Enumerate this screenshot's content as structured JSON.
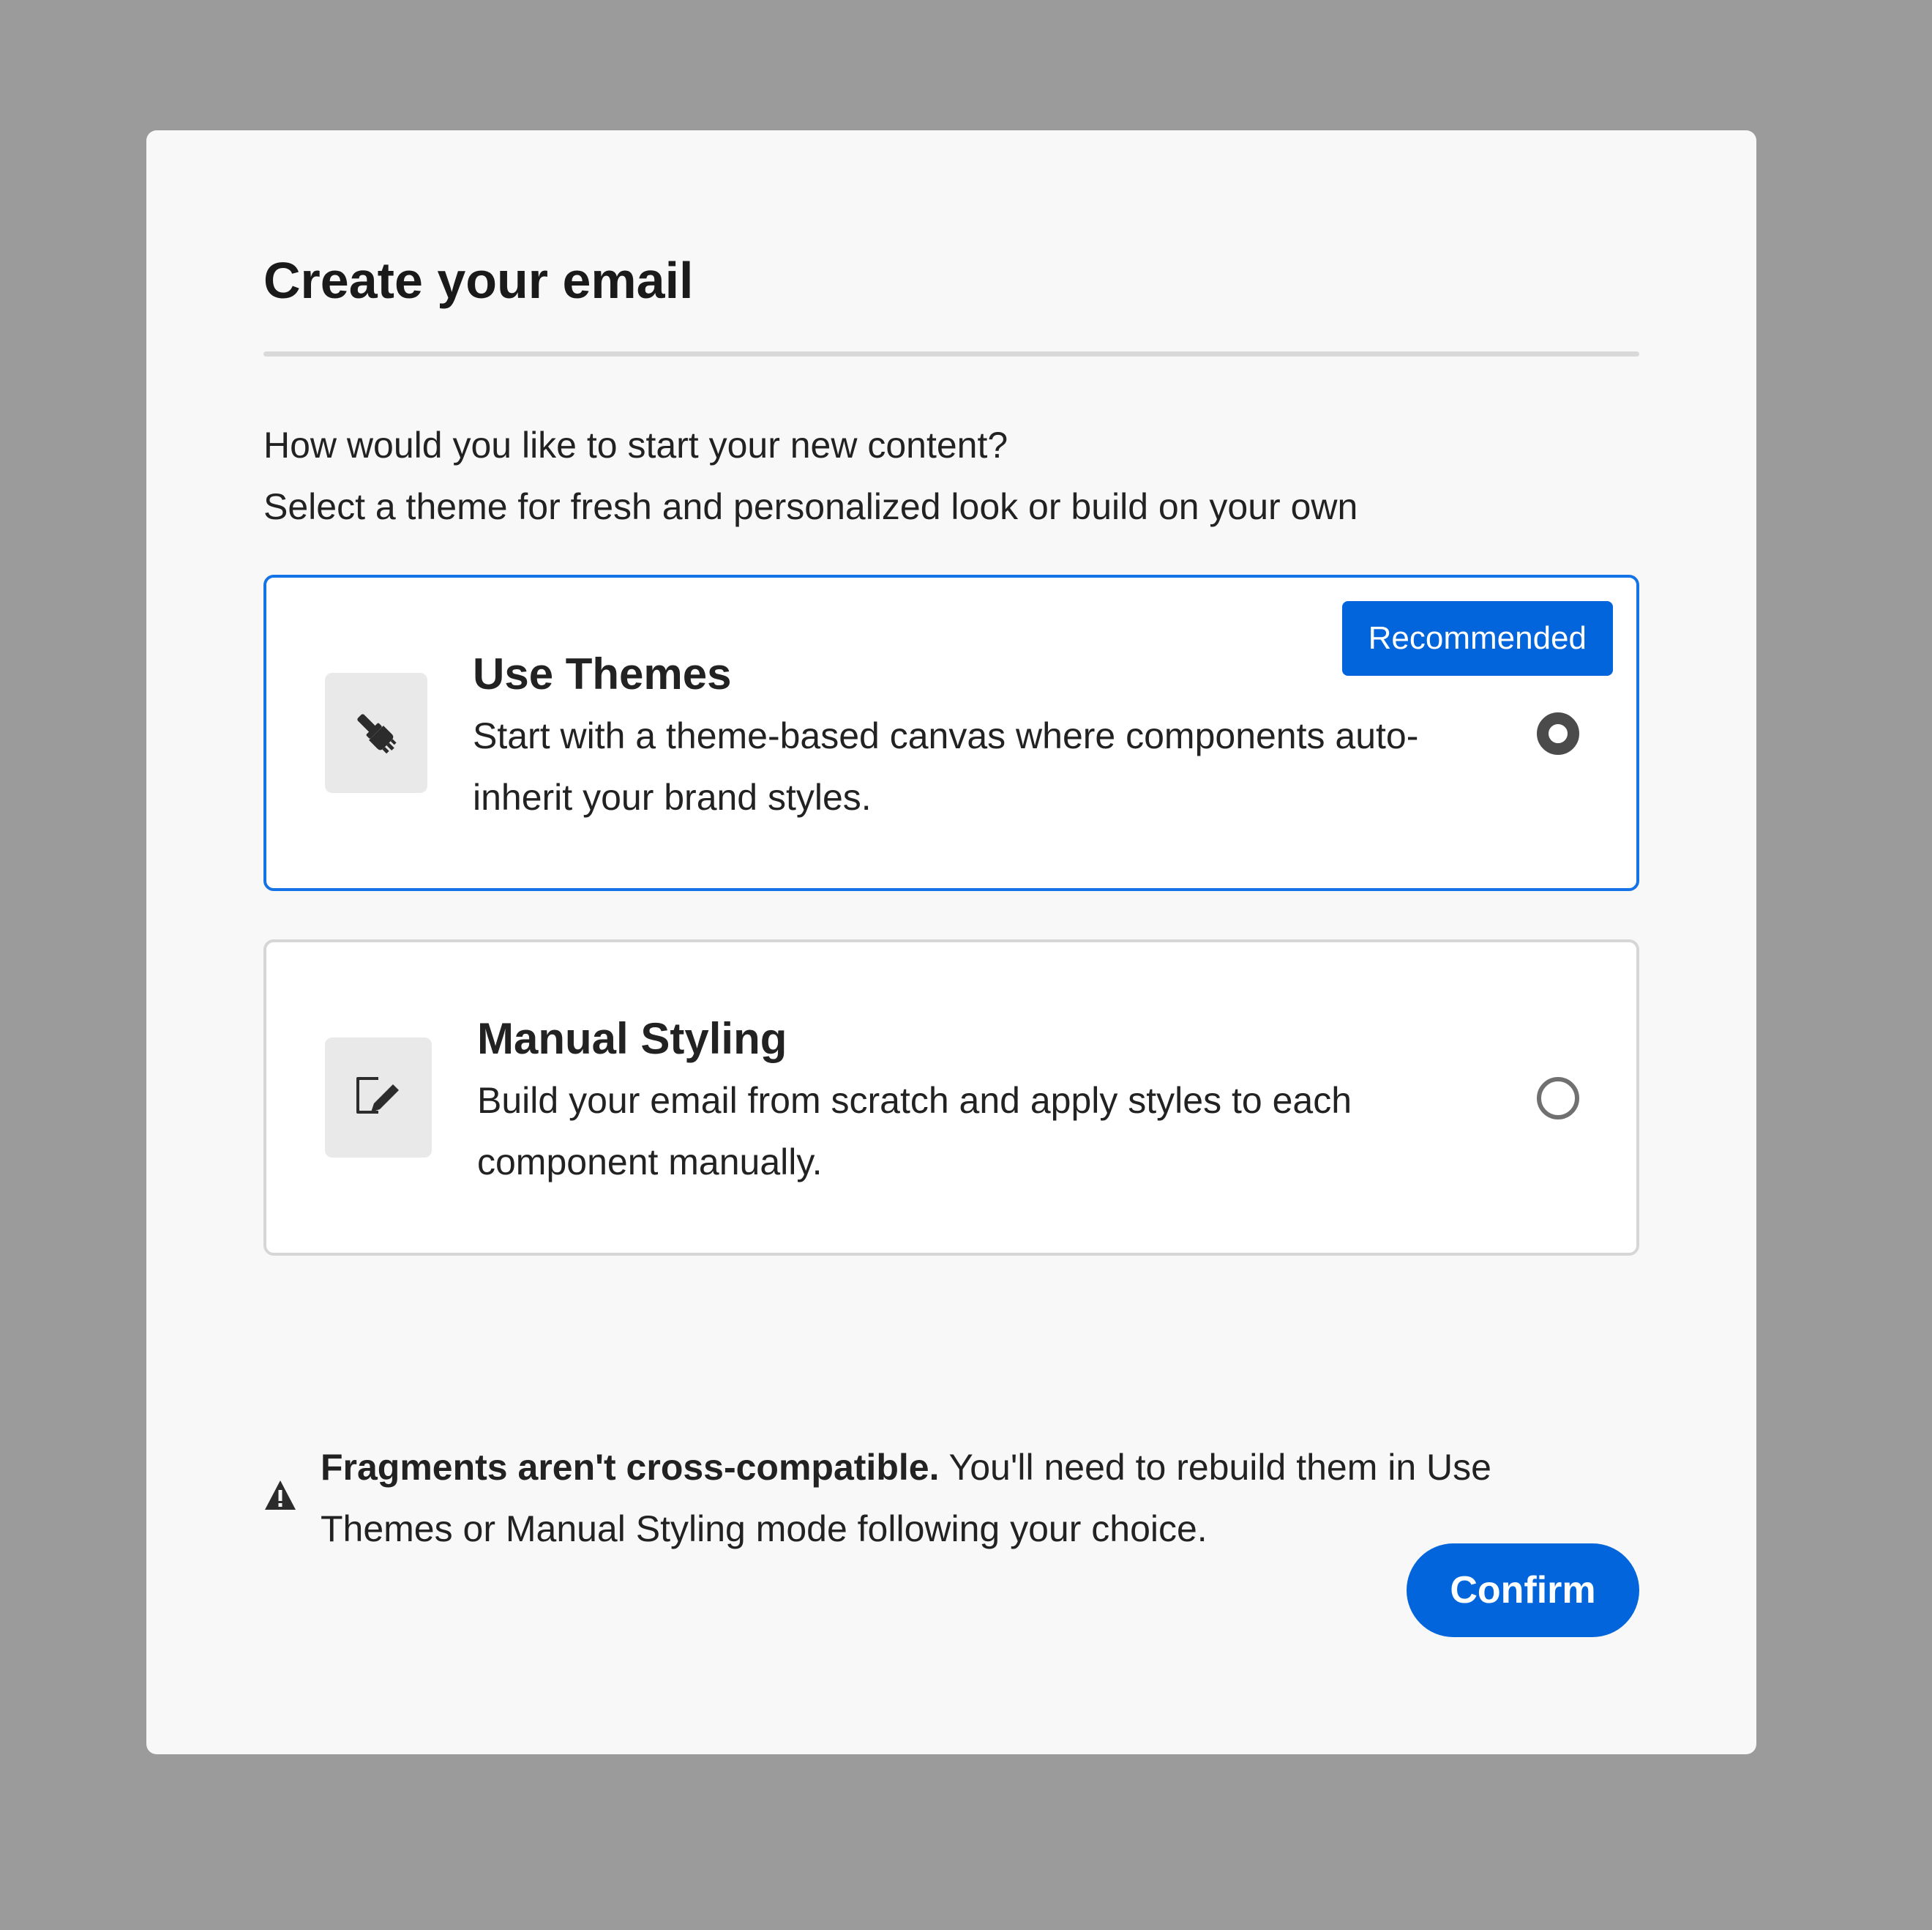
{
  "dialog": {
    "title": "Create your email",
    "subtitle_line1": "How would you like to start your new content?",
    "subtitle_line2": "Select a theme for fresh and personalized look or build on your own"
  },
  "options": [
    {
      "title": "Use Themes",
      "description": "Start with a theme-based canvas where components auto-inherit your brand styles.",
      "badge": "Recommended",
      "icon": "paintbrush-icon",
      "selected": true
    },
    {
      "title": "Manual Styling",
      "description": "Build your email from scratch and apply styles to each component manually.",
      "icon": "edit-icon",
      "selected": false
    }
  ],
  "notice": {
    "icon": "alert-triangle-icon",
    "bold_text": "Fragments aren't cross-compatible.",
    "text": " You'll need to rebuild them in Use Themes or Manual Styling mode following your choice."
  },
  "footer": {
    "confirm_label": "Confirm"
  },
  "colors": {
    "accent": "#0265dc",
    "selected_border": "#1473e6",
    "overlay": "#9b9b9b",
    "dialog_bg": "#f8f8f8"
  }
}
